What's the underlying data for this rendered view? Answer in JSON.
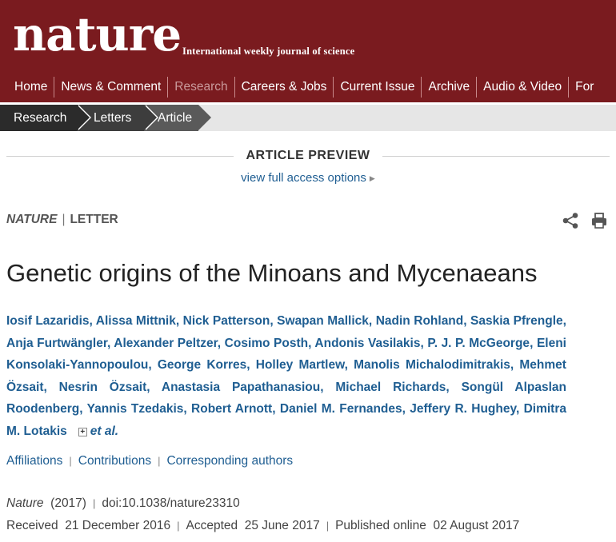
{
  "masthead": {
    "logo": "nature",
    "tagline": "International weekly journal of science",
    "background": "#7a1b1f"
  },
  "nav": {
    "items": [
      {
        "label": "Home"
      },
      {
        "label": "News & Comment"
      },
      {
        "label": "Research"
      },
      {
        "label": "Careers & Jobs"
      },
      {
        "label": "Current Issue"
      },
      {
        "label": "Archive"
      },
      {
        "label": "Audio & Video"
      },
      {
        "label": "For"
      }
    ]
  },
  "breadcrumb": {
    "items": [
      {
        "label": "Research"
      },
      {
        "label": "Letters"
      },
      {
        "label": "Article"
      }
    ]
  },
  "preview": {
    "title": "ARTICLE PREVIEW",
    "access_link": "view full access options"
  },
  "article": {
    "journal": "NATURE",
    "type": "LETTER",
    "title": "Genetic origins of the Minoans and Mycenaeans",
    "authors": [
      "Iosif Lazaridis",
      "Alissa Mittnik",
      "Nick Patterson",
      "Swapan Mallick",
      "Nadin Rohland",
      "Saskia Pfrengle",
      "Anja Furtwängler",
      "Alexander Peltzer",
      "Cosimo Posth",
      "Andonis Vasilakis",
      "P. J. P. McGeorge",
      "Eleni Konsolaki-Yannopoulou",
      "George Korres",
      "Holley Martlew",
      "Manolis Michalodimitrakis",
      "Mehmet Özsait",
      "Nesrin Özsait",
      "Anastasia Papathanasiou",
      "Michael Richards",
      "Songül Alpaslan Roodenberg",
      "Yannis Tzedakis",
      "Robert Arnott",
      "Daniel M. Fernandes",
      "Jeffery R. Hughey",
      "Dimitra M. Lotakis"
    ],
    "expand_symbol": "+",
    "etal": "et al.",
    "links": [
      "Affiliations",
      "Contributions",
      "Corresponding authors"
    ],
    "citation": {
      "journal": "Nature",
      "year": "(2017)",
      "doi": "doi:10.1038/nature23310"
    },
    "dates": {
      "received_label": "Received",
      "received": "21 December 2016",
      "accepted_label": "Accepted",
      "accepted": "25 June 2017",
      "published_label": "Published online",
      "published": "02 August 2017"
    }
  },
  "icons": {
    "share": "share-icon",
    "print": "print-icon"
  },
  "colors": {
    "link": "#1f5e92",
    "masthead": "#7a1b1f"
  }
}
